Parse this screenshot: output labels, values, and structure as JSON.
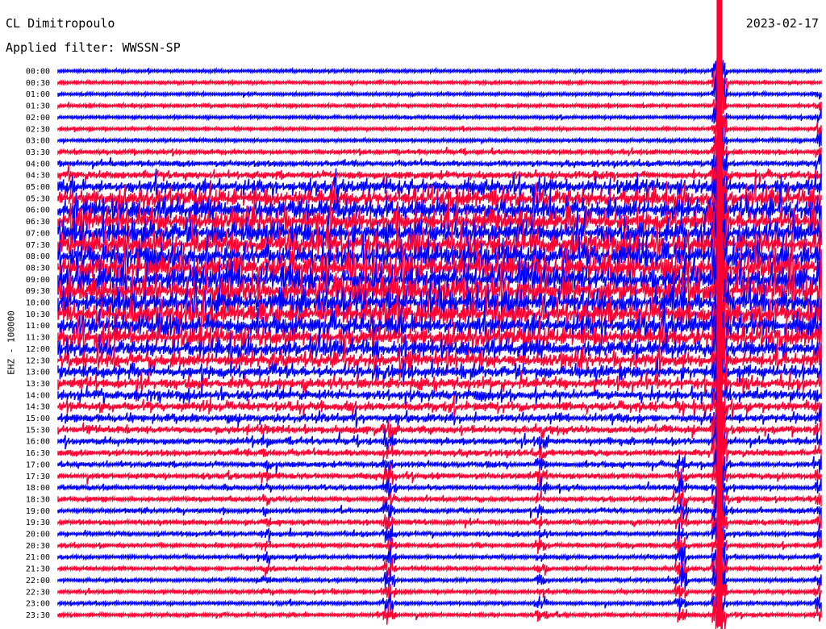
{
  "header": {
    "station": "CL Dimitropoulo",
    "date": "2023-02-17",
    "filter": "Applied filter: WWSSN-SP"
  },
  "chart_data": {
    "type": "line",
    "title": "CL Dimitropoulo",
    "ylabel": "EHZ - 100000",
    "xlabel": "",
    "row_labels": [
      "00:00",
      "00:30",
      "01:00",
      "01:30",
      "02:00",
      "02:30",
      "03:00",
      "03:30",
      "04:00",
      "04:30",
      "05:00",
      "05:30",
      "06:00",
      "06:30",
      "07:00",
      "07:30",
      "08:00",
      "08:30",
      "09:00",
      "09:30",
      "10:00",
      "10:30",
      "11:00",
      "11:30",
      "12:00",
      "12:30",
      "13:00",
      "13:30",
      "14:00",
      "14:30",
      "15:00",
      "15:30",
      "16:00",
      "16:30",
      "17:00",
      "17:30",
      "18:00",
      "18:30",
      "19:00",
      "19:30",
      "20:00",
      "20:30",
      "21:00",
      "21:30",
      "22:00",
      "22:30",
      "23:00",
      "23:30"
    ],
    "trace_colors": [
      "#0000ff",
      "#ff0033"
    ],
    "row_amplitude": [
      0.15,
      0.15,
      0.15,
      0.15,
      0.15,
      0.15,
      0.18,
      0.25,
      0.4,
      0.6,
      1.2,
      1.6,
      1.9,
      2.0,
      2.1,
      2.2,
      2.3,
      2.4,
      2.5,
      2.4,
      2.3,
      2.1,
      1.9,
      1.7,
      1.5,
      1.3,
      1.1,
      1.0,
      0.9,
      0.8,
      0.7,
      0.6,
      0.5,
      0.45,
      0.4,
      0.35,
      0.3,
      0.3,
      0.3,
      0.3,
      0.28,
      0.25,
      0.22,
      0.2,
      0.2,
      0.2,
      0.2,
      0.2
    ],
    "events": [
      {
        "minute": 26.0,
        "row_start": 0,
        "row_end": 48,
        "amplitude": 40
      },
      {
        "minute": 13.0,
        "row_start": 31,
        "row_end": 48,
        "amplitude": 12
      },
      {
        "minute": 8.2,
        "row_start": 31,
        "row_end": 46,
        "amplitude": 6
      },
      {
        "minute": 19.0,
        "row_start": 31,
        "row_end": 48,
        "amplitude": 8
      },
      {
        "minute": 24.5,
        "row_start": 34,
        "row_end": 48,
        "amplitude": 14
      },
      {
        "minute": 30.0,
        "row_start": 2,
        "row_end": 48,
        "amplitude": 10
      },
      {
        "minute": 44.5,
        "row_start": 31,
        "row_end": 48,
        "amplitude": 18
      },
      {
        "minute": 51.5,
        "row_start": 34,
        "row_end": 48,
        "amplitude": 12
      }
    ]
  }
}
